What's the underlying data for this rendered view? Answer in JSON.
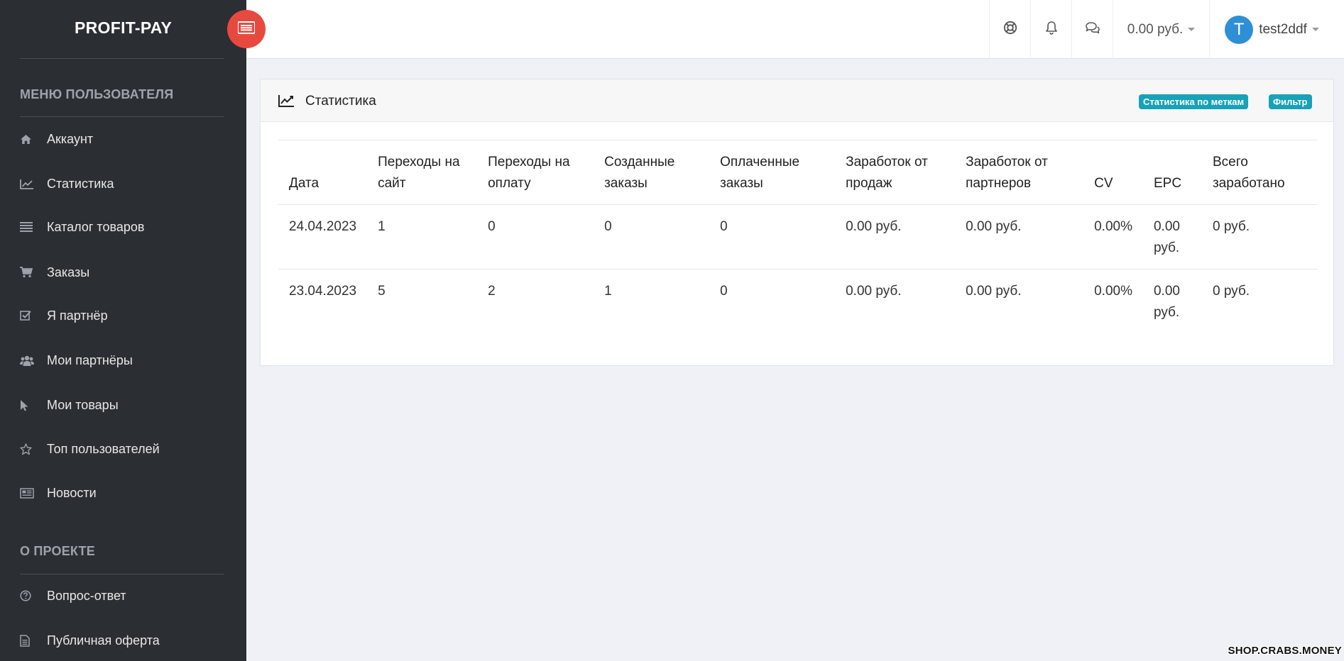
{
  "brand": {
    "name": "PROFIT-PAY"
  },
  "sidebar": {
    "user_menu_title": "МЕНЮ ПОЛЬЗОВАТЕЛЯ",
    "user_items": [
      {
        "label": "Аккаунт",
        "icon": "home-icon"
      },
      {
        "label": "Статистика",
        "icon": "line-chart-icon"
      },
      {
        "label": "Каталог товаров",
        "icon": "list-icon"
      },
      {
        "label": "Заказы",
        "icon": "cart-icon"
      },
      {
        "label": "Я партнёр",
        "icon": "check-square-icon"
      },
      {
        "label": "Мои партнёры",
        "icon": "users-icon"
      },
      {
        "label": "Мои товары",
        "icon": "cursor-icon"
      },
      {
        "label": "Топ пользователей",
        "icon": "star-icon"
      },
      {
        "label": "Новости",
        "icon": "newspaper-icon"
      }
    ],
    "project_title": "О ПРОЕКТЕ",
    "project_items": [
      {
        "label": "Вопрос-ответ",
        "icon": "question-circle-icon"
      },
      {
        "label": "Публичная оферта",
        "icon": "document-icon"
      }
    ]
  },
  "topbar": {
    "balance": "0.00 руб.",
    "username": "test2ddf",
    "avatar_letter": "T"
  },
  "card": {
    "title": "Статистика",
    "badges": {
      "by_tags": "Статистика по меткам",
      "filter": "Фильтр"
    }
  },
  "table": {
    "headers": [
      "Дата",
      "Переходы на сайт",
      "Переходы на оплату",
      "Созданные заказы",
      "Оплаченные заказы",
      "Заработок от продаж",
      "Заработок от партнеров",
      "CV",
      "EPC",
      "Всего заработано"
    ],
    "rows": [
      [
        "24.04.2023",
        "1",
        "0",
        "0",
        "0",
        "0.00 руб.",
        "0.00 руб.",
        "0.00%",
        "0.00 руб.",
        "0 руб."
      ],
      [
        "23.04.2023",
        "5",
        "2",
        "1",
        "0",
        "0.00 руб.",
        "0.00 руб.",
        "0.00%",
        "0.00 руб.",
        "0 руб."
      ]
    ]
  },
  "watermark": "SHOP.CRABS.MONEY",
  "colors": {
    "sidebar_bg": "#2b2e33",
    "accent_red": "#e8493f",
    "badge_teal": "#17a2b8",
    "avatar_blue": "#2e8fd6",
    "page_bg": "#f0f1f6"
  }
}
